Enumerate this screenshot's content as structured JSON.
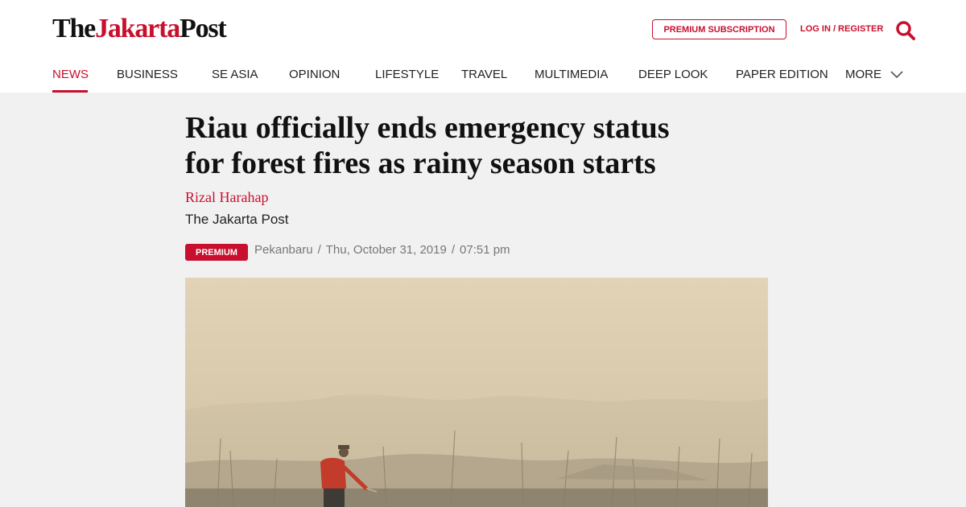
{
  "header": {
    "logo": {
      "part1": "The",
      "part2": "Jakarta",
      "part3": "Post"
    },
    "premium_subscription": "PREMIUM SUBSCRIPTION",
    "login_register": "LOG IN / REGISTER",
    "search_icon": "search-icon"
  },
  "nav": {
    "items": [
      {
        "label": "NEWS",
        "active": true
      },
      {
        "label": "BUSINESS"
      },
      {
        "label": "SE ASIA"
      },
      {
        "label": "OPINION"
      },
      {
        "label": "LIFESTYLE"
      },
      {
        "label": "TRAVEL"
      },
      {
        "label": "MULTIMEDIA"
      },
      {
        "label": "DEEP LOOK"
      },
      {
        "label": "PAPER EDITION"
      },
      {
        "label": "MORE"
      }
    ],
    "more_icon": "chevron-down-icon"
  },
  "article": {
    "headline_line1": "Riau officially ends emergency status",
    "headline_line2": "for forest fires as rainy season starts",
    "author": "Rizal Harahap",
    "publication": "The Jakarta Post",
    "badge": "PREMIUM",
    "location": "Pekanbaru",
    "separator": "/",
    "date": "Thu, October 31, 2019",
    "time": "07:51 pm"
  },
  "colors": {
    "accent": "#c8102e",
    "background": "#f1f1f1",
    "text": "#111111",
    "meta": "#777777"
  }
}
